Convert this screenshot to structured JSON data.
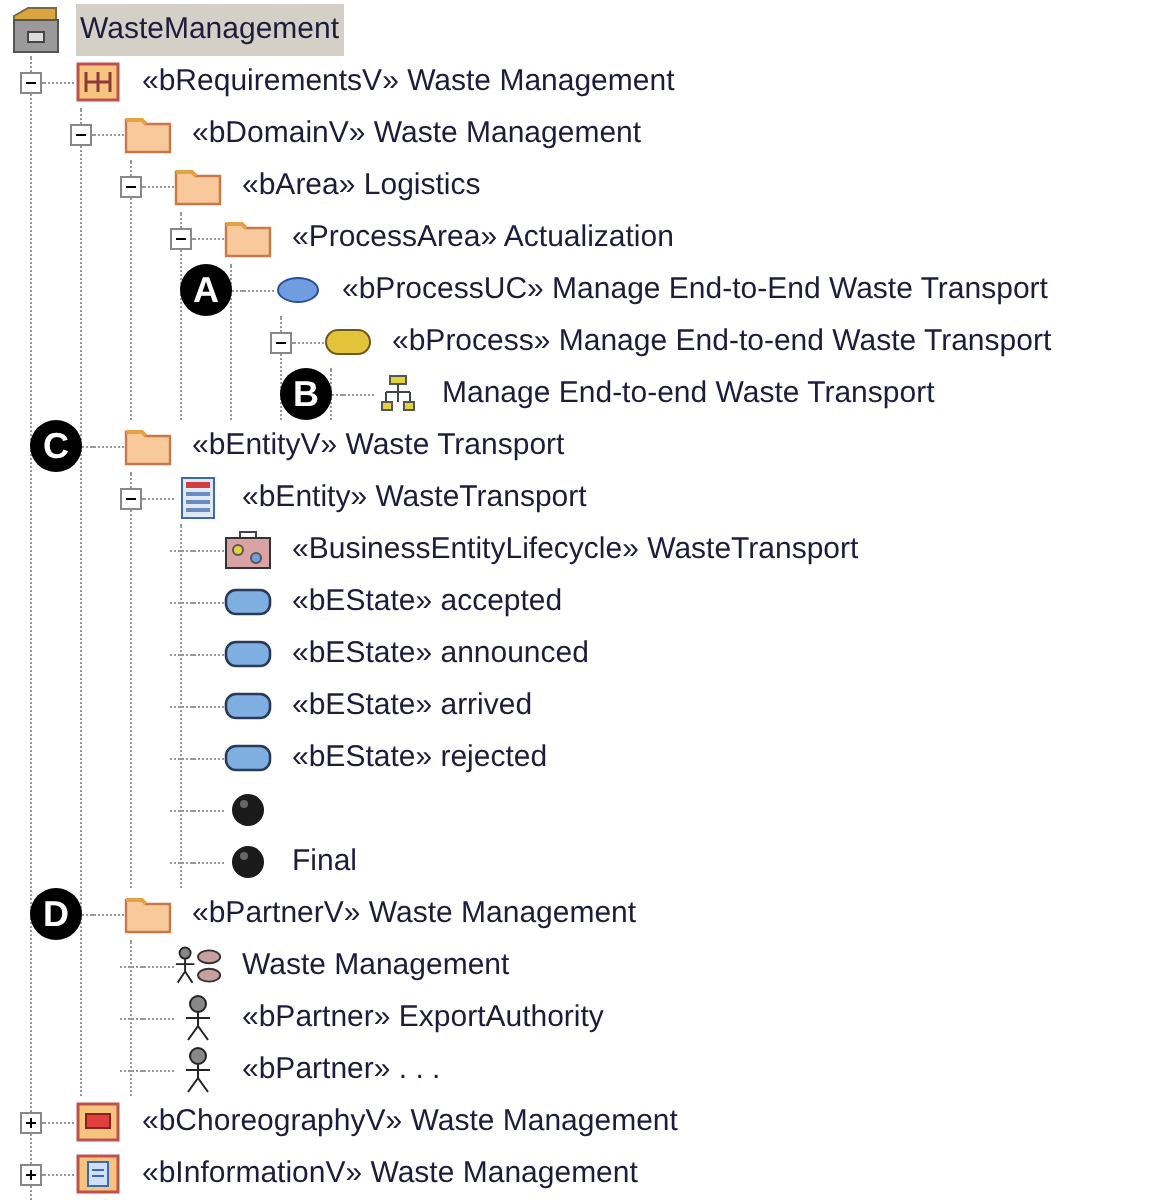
{
  "tree": {
    "label": "WasteManagement",
    "kind": "model",
    "selected": true,
    "children": [
      {
        "label": "«bRequirementsV» Waste Management",
        "kind": "requirements",
        "selected": false,
        "expanded": true,
        "children": [
          {
            "label": "«bDomainV» Waste Management",
            "kind": "folder",
            "selected": false,
            "expanded": true,
            "children": [
              {
                "label": "«bArea» Logistics",
                "kind": "folder",
                "selected": false,
                "expanded": true,
                "children": [
                  {
                    "label": "«ProcessArea» Actualization",
                    "kind": "folder",
                    "selected": false,
                    "expanded": true,
                    "children": [
                      {
                        "label": "«bProcessUC» Manage End-to-End Waste Transport",
                        "kind": "usecase",
                        "selected": false,
                        "marker": "A",
                        "children": [
                          {
                            "label": "«bProcess» Manage End-to-end Waste Transport",
                            "kind": "process",
                            "selected": false,
                            "expanded": true,
                            "children": [
                              {
                                "label": "Manage End-to-end Waste Transport",
                                "kind": "activity",
                                "selected": false,
                                "marker": "B"
                              }
                            ]
                          }
                        ]
                      }
                    ]
                  }
                ]
              }
            ]
          },
          {
            "label": "«bEntityV» Waste Transport",
            "kind": "folder",
            "selected": false,
            "marker": "C",
            "children": [
              {
                "label": "«bEntity» WasteTransport",
                "kind": "entity",
                "selected": false,
                "expanded": true,
                "children": [
                  {
                    "label": "«BusinessEntityLifecycle» WasteTransport",
                    "kind": "lifecycle",
                    "selected": false
                  },
                  {
                    "label": "«bEState» accepted",
                    "kind": "state",
                    "selected": false
                  },
                  {
                    "label": "«bEState» announced",
                    "kind": "state",
                    "selected": false
                  },
                  {
                    "label": "«bEState» arrived",
                    "kind": "state",
                    "selected": false
                  },
                  {
                    "label": "«bEState» rejected",
                    "kind": "state",
                    "selected": false
                  },
                  {
                    "kind": "node",
                    "selected": false
                  },
                  {
                    "label": "Final",
                    "kind": "node",
                    "selected": false
                  }
                ]
              }
            ]
          },
          {
            "label": "«bPartnerV» Waste Management",
            "kind": "folder",
            "selected": false,
            "marker": "D",
            "children": [
              {
                "label": "Waste Management",
                "kind": "partners",
                "selected": false
              },
              {
                "label": "«bPartner» ExportAuthority",
                "kind": "actor",
                "selected": false
              },
              {
                "label": "«bPartner» . . .",
                "kind": "actor",
                "selected": false
              }
            ]
          }
        ]
      },
      {
        "label": "«bChoreographyV» Waste Management",
        "kind": "choreography",
        "selected": false,
        "expanded": false
      },
      {
        "label": "«bInformationV» Waste Management",
        "kind": "information",
        "selected": false,
        "expanded": false
      }
    ]
  }
}
